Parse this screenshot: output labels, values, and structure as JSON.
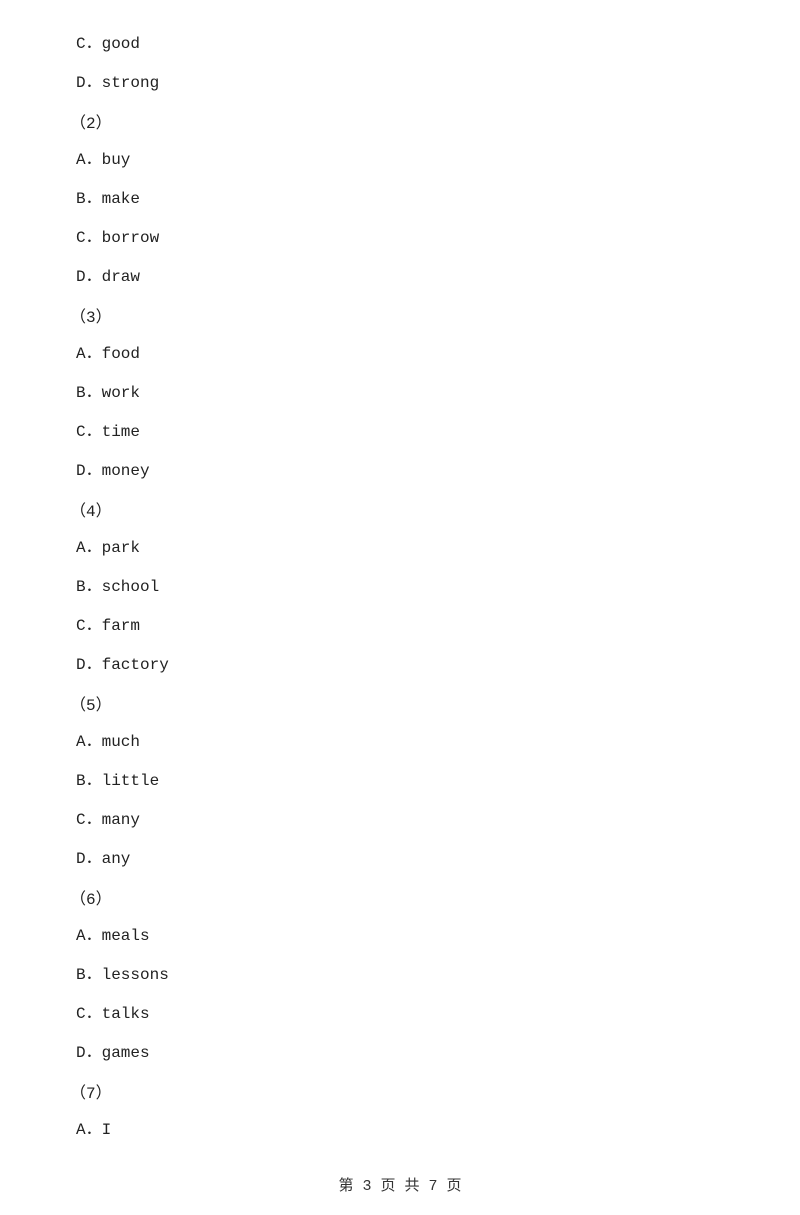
{
  "content": {
    "lines": [
      {
        "type": "option",
        "text": "C．good"
      },
      {
        "type": "option",
        "text": "D．strong"
      },
      {
        "type": "section",
        "text": "（2）"
      },
      {
        "type": "option",
        "text": "A．buy"
      },
      {
        "type": "option",
        "text": "B．make"
      },
      {
        "type": "option",
        "text": "C．borrow"
      },
      {
        "type": "option",
        "text": "D．draw"
      },
      {
        "type": "section",
        "text": "（3）"
      },
      {
        "type": "option",
        "text": "A．food"
      },
      {
        "type": "option",
        "text": "B．work"
      },
      {
        "type": "option",
        "text": "C．time"
      },
      {
        "type": "option",
        "text": "D．money"
      },
      {
        "type": "section",
        "text": "（4）"
      },
      {
        "type": "option",
        "text": "A．park"
      },
      {
        "type": "option",
        "text": "B．school"
      },
      {
        "type": "option",
        "text": "C．farm"
      },
      {
        "type": "option",
        "text": "D．factory"
      },
      {
        "type": "section",
        "text": "（5）"
      },
      {
        "type": "option",
        "text": "A．much"
      },
      {
        "type": "option",
        "text": "B．little"
      },
      {
        "type": "option",
        "text": "C．many"
      },
      {
        "type": "option",
        "text": "D．any"
      },
      {
        "type": "section",
        "text": "（6）"
      },
      {
        "type": "option",
        "text": "A．meals"
      },
      {
        "type": "option",
        "text": "B．lessons"
      },
      {
        "type": "option",
        "text": "C．talks"
      },
      {
        "type": "option",
        "text": "D．games"
      },
      {
        "type": "section",
        "text": "（7）"
      },
      {
        "type": "option",
        "text": "A．I"
      }
    ],
    "footer": "第 3 页 共 7 页"
  }
}
